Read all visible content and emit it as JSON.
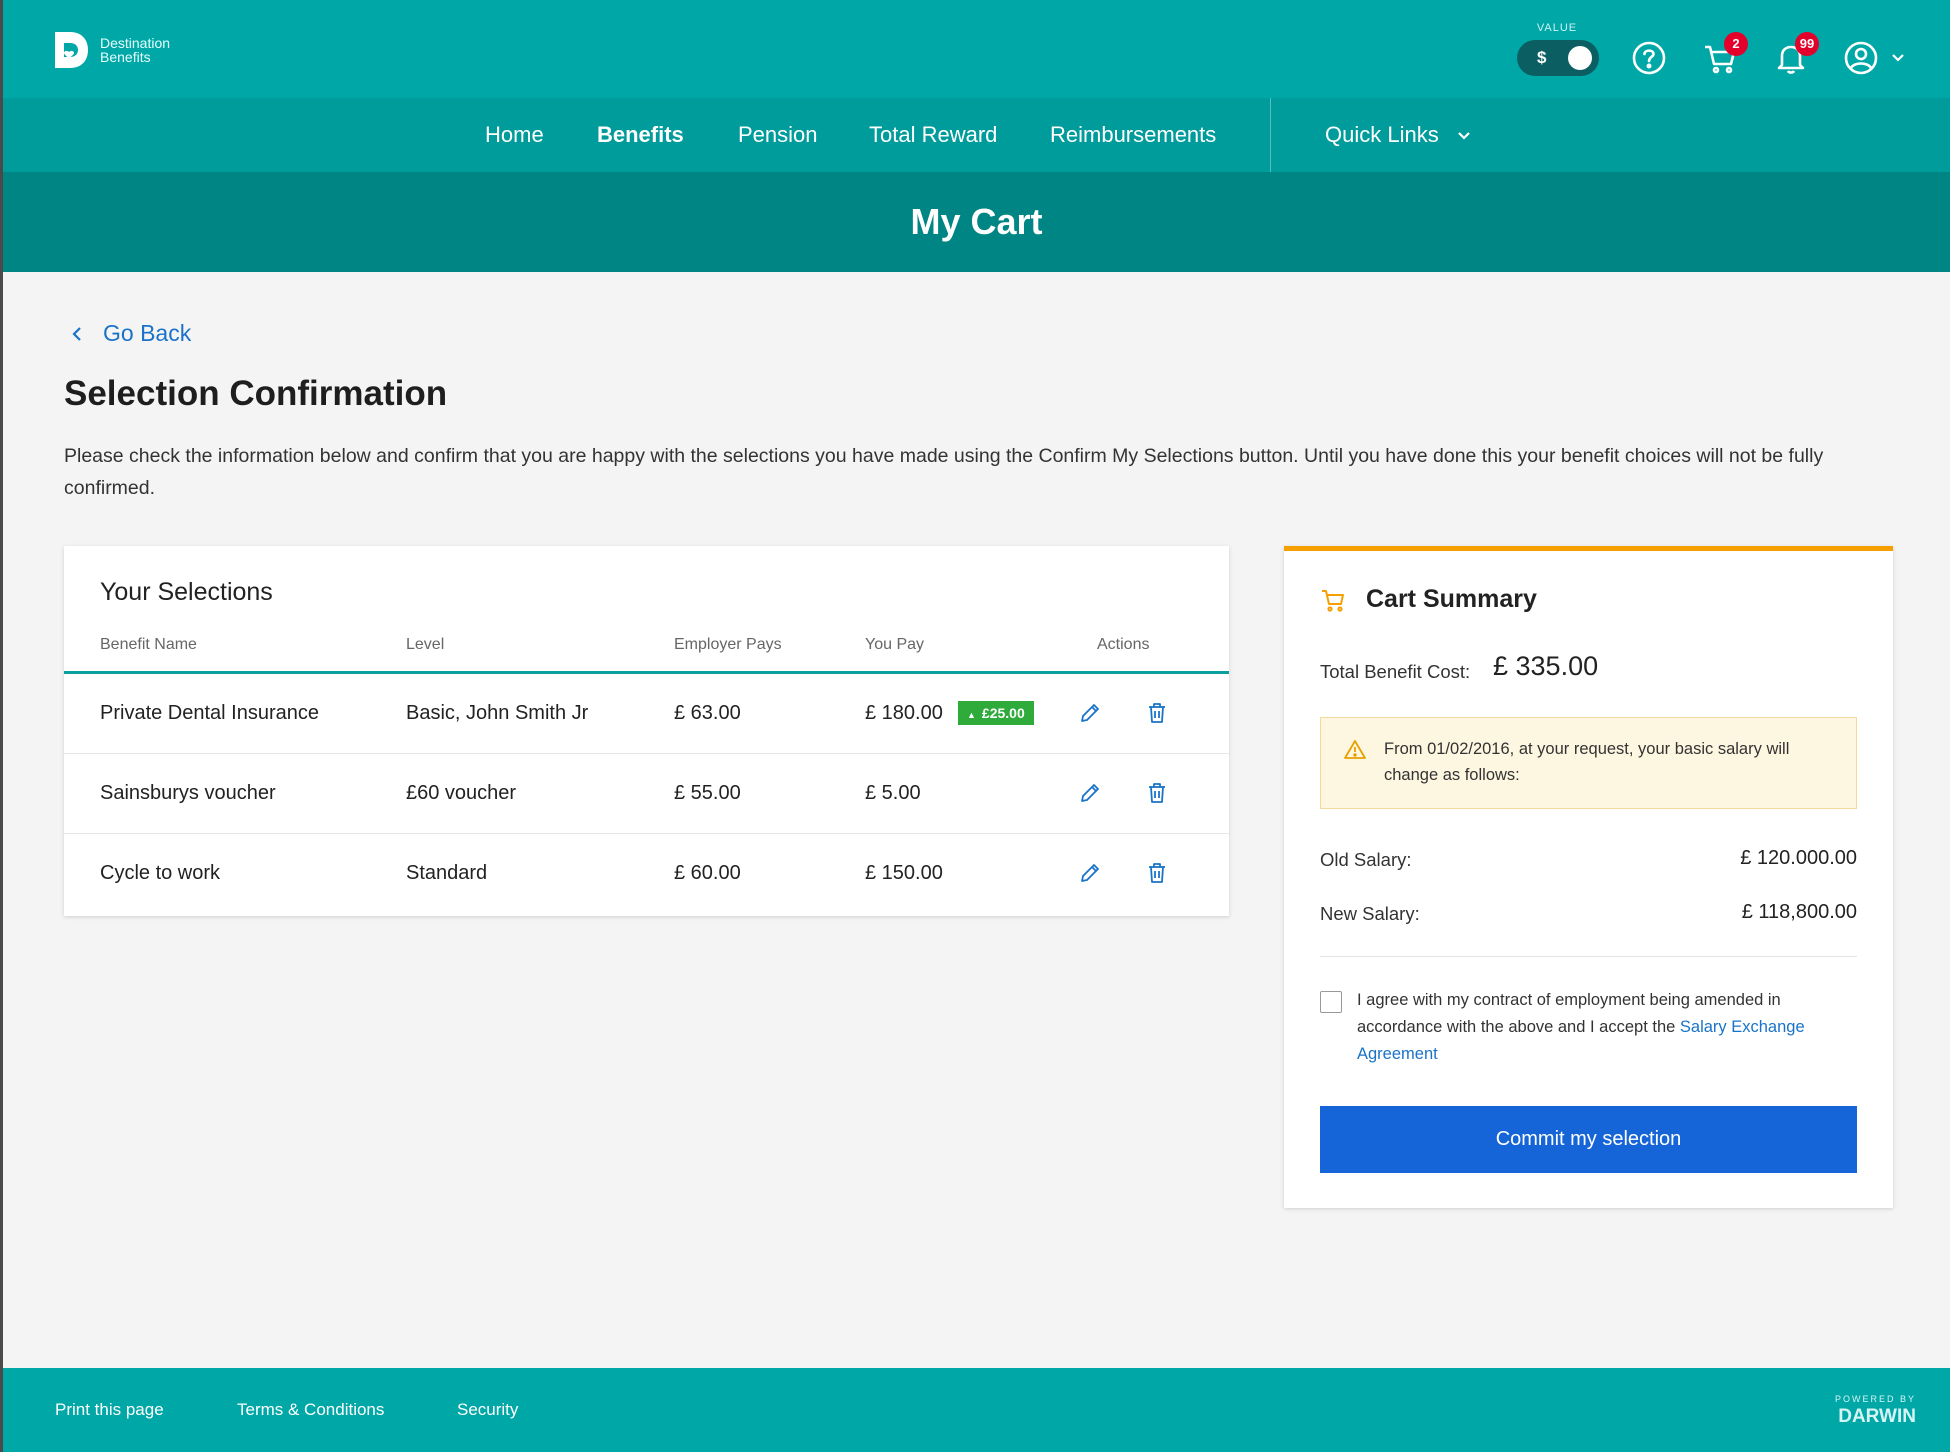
{
  "brand": {
    "line1": "Destination",
    "line2": "Benefits"
  },
  "header": {
    "value_label": "VALUE",
    "currency_symbol": "$",
    "cart_count": "2",
    "notif_count": "99"
  },
  "nav": {
    "items": [
      {
        "label": "Home",
        "active": false
      },
      {
        "label": "Benefits",
        "active": true
      },
      {
        "label": "Pension",
        "active": false
      },
      {
        "label": "Total Reward",
        "active": false
      },
      {
        "label": "Reimbursements",
        "active": false
      }
    ],
    "quick_links": "Quick Links"
  },
  "page": {
    "title": "My Cart",
    "go_back": "Go Back",
    "heading": "Selection Confirmation",
    "intro": "Please check the information below and confirm that you are happy with the selections you have made using the Confirm My Selections button. Until you have done this your benefit choices will not be fully confirmed."
  },
  "selections": {
    "title": "Your Selections",
    "columns": [
      "Benefit Name",
      "Level",
      "Employer Pays",
      "You Pay",
      "Actions"
    ],
    "rows": [
      {
        "name": "Private Dental Insurance",
        "level": "Basic, John Smith Jr",
        "employer": "£ 63.00",
        "you": "£ 180.00",
        "badge": "£25.00"
      },
      {
        "name": "Sainsburys voucher",
        "level": "£60 voucher",
        "employer": "£ 55.00",
        "you": "£ 5.00"
      },
      {
        "name": "Cycle to work",
        "level": "Standard",
        "employer": "£ 60.00",
        "you": "£ 150.00"
      }
    ]
  },
  "summary": {
    "title": "Cart Summary",
    "total_label": "Total Benefit Cost:",
    "total_value": "£ 335.00",
    "warning": "From 01/02/2016, at your request, your basic salary will change as follows:",
    "old_label": "Old Salary:",
    "old_value": "£ 120.000.00",
    "new_label": "New Salary:",
    "new_value": "£ 118,800.00",
    "agree_text": "I agree with my contract of employment being amended in accordance with the above and I accept the ",
    "agree_link": "Salary Exchange Agreement",
    "commit_label": "Commit my selection"
  },
  "footer": {
    "links": [
      "Print this page",
      "Terms & Conditions",
      "Security"
    ],
    "powered_by": "POWERED BY",
    "powered_brand": "DARWIN"
  },
  "colors": {
    "primary": "#00a7a7",
    "nav": "#009b9b",
    "title_band": "#008585",
    "accent_orange": "#f5a000",
    "button_blue": "#1565d8",
    "link_blue": "#1a73c8",
    "badge_green": "#2eab3a",
    "badge_red": "#e3002b"
  }
}
